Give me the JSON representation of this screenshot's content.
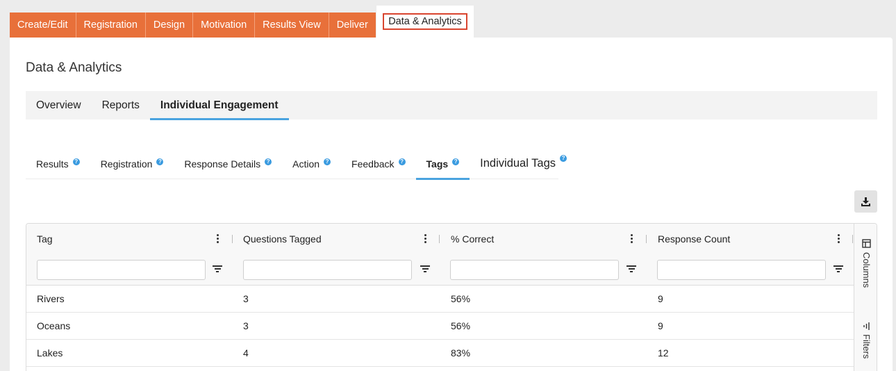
{
  "top_tabs": [
    "Create/Edit",
    "Registration",
    "Design",
    "Motivation",
    "Results View",
    "Deliver"
  ],
  "active_top_tab": "Data & Analytics",
  "page_title": "Data & Analytics",
  "sub_tabs": [
    "Overview",
    "Reports",
    "Individual Engagement"
  ],
  "active_sub_tab": "Individual Engagement",
  "inner_tabs": [
    "Results",
    "Registration",
    "Response Details",
    "Action",
    "Feedback",
    "Tags",
    "Individual Tags"
  ],
  "active_inner_tab": "Tags",
  "grid": {
    "columns": [
      "Tag",
      "Questions Tagged",
      "% Correct",
      "Response Count"
    ],
    "rows": [
      [
        "Rivers",
        "3",
        "56%",
        "9"
      ],
      [
        "Oceans",
        "3",
        "56%",
        "9"
      ],
      [
        "Lakes",
        "4",
        "83%",
        "12"
      ]
    ],
    "side_panel": [
      "Columns",
      "Filters"
    ]
  },
  "icons": {
    "download": "download-icon",
    "help": "help-icon",
    "menu": "kebab-menu-icon",
    "filter": "filter-icon",
    "columns": "columns-icon",
    "filters": "filters-icon"
  },
  "colors": {
    "tab_orange": "#e8703a",
    "highlight_red": "#d9452f",
    "accent_blue": "#4aa3df"
  }
}
